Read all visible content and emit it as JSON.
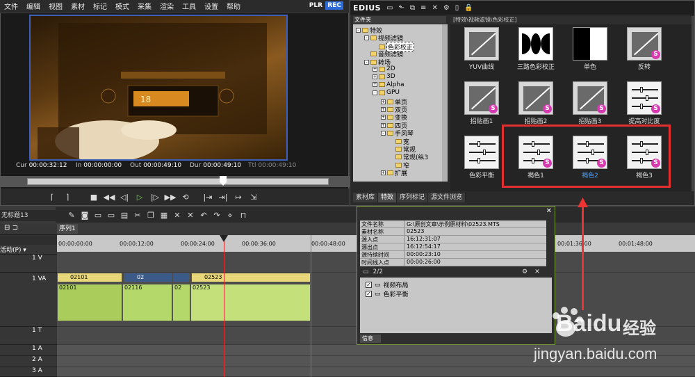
{
  "menu": [
    "文件",
    "编辑",
    "视图",
    "素材",
    "标记",
    "模式",
    "采集",
    "渲染",
    "工具",
    "设置",
    "帮助"
  ],
  "plr": "PLR",
  "rec": "REC",
  "player": {
    "cur": "00:00:32:12",
    "in": "00:00:00:00",
    "out": "00:00:49:10",
    "dur": "00:00:49:10",
    "ttl": "00:00:49:10",
    "cur_label": "Cur",
    "in_label": "In",
    "out_label": "Out",
    "dur_label": "Dur",
    "ttl_label": "Ttl",
    "scrub_position": 0.65
  },
  "fx": {
    "app": "EDIUS",
    "tree_header": "文件夹",
    "grid_header": "[特效\\视频滤镜\\色彩校正]",
    "tree": [
      {
        "label": "特效",
        "depth": 0,
        "exp": "-"
      },
      {
        "label": "视频滤镜",
        "depth": 1,
        "exp": "-"
      },
      {
        "label": "色彩校正",
        "depth": 2,
        "exp": "",
        "selected": true
      },
      {
        "label": "音频滤镜",
        "depth": 1,
        "exp": ""
      },
      {
        "label": "转场",
        "depth": 1,
        "exp": "-"
      },
      {
        "label": "2D",
        "depth": 2,
        "exp": "+"
      },
      {
        "label": "3D",
        "depth": 2,
        "exp": "+"
      },
      {
        "label": "Alpha",
        "depth": 2,
        "exp": "+"
      },
      {
        "label": "GPU",
        "depth": 2,
        "exp": "-"
      },
      {
        "label": "单页",
        "depth": 3,
        "exp": "+"
      },
      {
        "label": "双页",
        "depth": 3,
        "exp": "+"
      },
      {
        "label": "变换",
        "depth": 3,
        "exp": "+"
      },
      {
        "label": "四页",
        "depth": 3,
        "exp": "+"
      },
      {
        "label": "手风琴",
        "depth": 3,
        "exp": "-"
      },
      {
        "label": "宽",
        "depth": 4,
        "exp": ""
      },
      {
        "label": "常规",
        "depth": 4,
        "exp": ""
      },
      {
        "label": "常规(纵3",
        "depth": 4,
        "exp": ""
      },
      {
        "label": "窄",
        "depth": 4,
        "exp": ""
      },
      {
        "label": "扩展",
        "depth": 3,
        "exp": "+"
      }
    ],
    "tabs": [
      "素材库",
      "特效",
      "序列标记",
      "源文件浏览"
    ],
    "active_tab": 1,
    "effects": [
      {
        "label": "YUV曲线",
        "kind": "curve",
        "s": false
      },
      {
        "label": "三路色彩校正",
        "kind": "circles",
        "s": false
      },
      {
        "label": "单色",
        "kind": "mono",
        "s": false
      },
      {
        "label": "反转",
        "kind": "curve",
        "s": true
      },
      {
        "label": "",
        "kind": "blank",
        "s": false
      },
      {
        "label": "招贴画1",
        "kind": "curve",
        "s": true
      },
      {
        "label": "招贴画2",
        "kind": "curve",
        "s": true
      },
      {
        "label": "招贴画3",
        "kind": "curve",
        "s": true
      },
      {
        "label": "提高对比度",
        "kind": "slider",
        "s": true
      },
      {
        "label": "",
        "kind": "blank",
        "s": false
      },
      {
        "label": "色彩平衡",
        "kind": "slider",
        "s": false
      },
      {
        "label": "褐色1",
        "kind": "slider",
        "s": true
      },
      {
        "label": "褐色2",
        "kind": "slider",
        "s": true,
        "selected": true
      },
      {
        "label": "褐色3",
        "kind": "slider",
        "s": true
      }
    ]
  },
  "timeline": {
    "title": "无标题13",
    "seq_tab": "序列1",
    "ruler": [
      "00:00:00:00",
      "00:00:12:00",
      "00:00:24:00",
      "00:00:36:00",
      "00:00:48:00",
      "00:01:36:00",
      "00:01:48:00"
    ],
    "track_label_0": "1 V",
    "track_label_1": "1 VA",
    "track_label_2": "1 T",
    "track_label_3": "1 A",
    "track_label_4": "2 A",
    "track_label_5": "3 A",
    "video_clips": [
      "02101",
      "02",
      "",
      "02523"
    ],
    "audio_clips": [
      "02101",
      "02116",
      "02",
      "02523"
    ],
    "misc_label": "活动(P) ▾"
  },
  "info": {
    "rows": [
      {
        "k": "文件名称",
        "v": "G:\\原创文章\\示例原材料\\02523.MTS"
      },
      {
        "k": "素材名称",
        "v": "02523"
      },
      {
        "k": "源入点",
        "v": "16:12:31:07"
      },
      {
        "k": "源出点",
        "v": "16:12:54:17"
      },
      {
        "k": "源持续时间",
        "v": "00:00:23:10"
      },
      {
        "k": "时间线入点",
        "v": "00:00:26:00"
      }
    ],
    "page": "2/2",
    "items": [
      "视频布局",
      "色彩平衡"
    ],
    "tab": "信息"
  },
  "watermark": {
    "brand": "Baidu",
    "jing": "经验",
    "url": "jingyan.baidu.com"
  }
}
